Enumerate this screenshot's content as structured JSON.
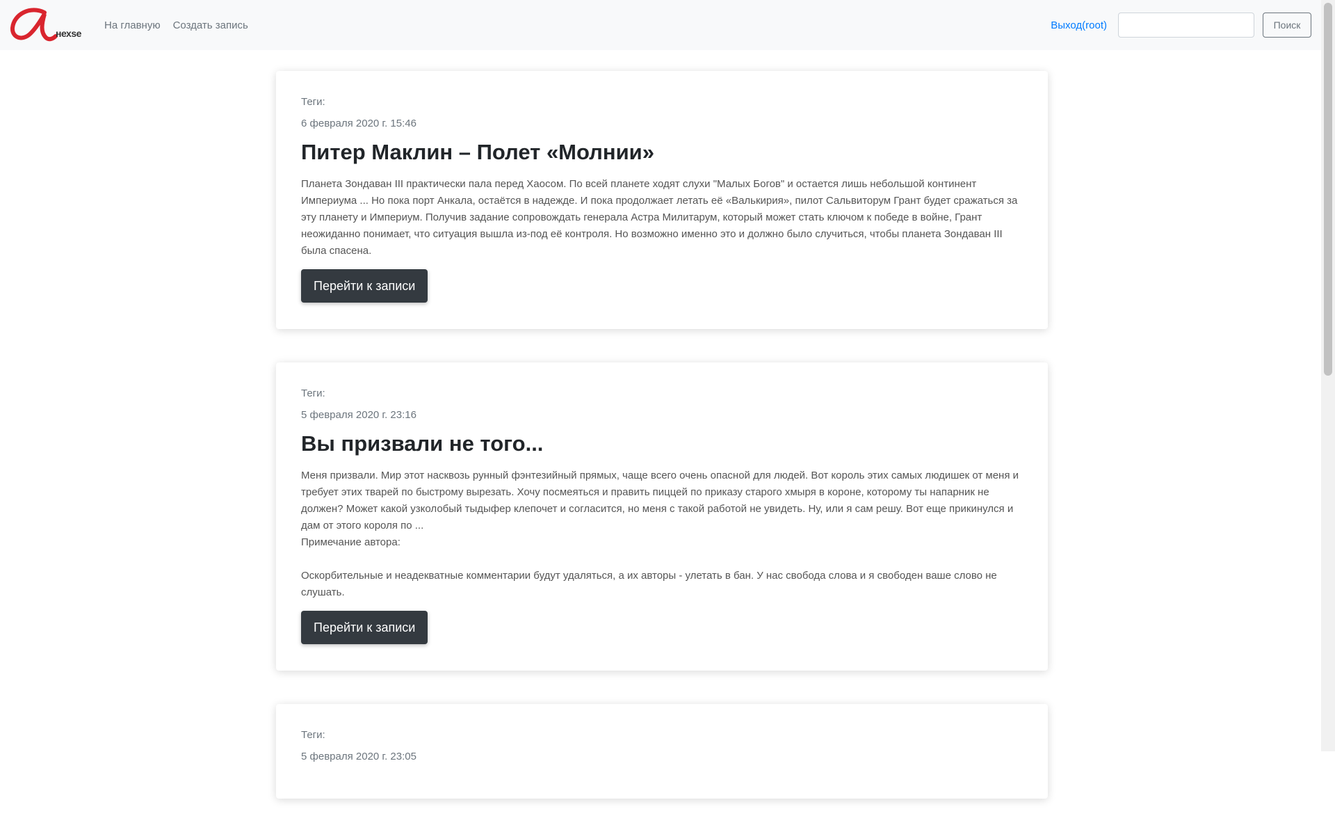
{
  "navbar": {
    "logo_text": "нехse",
    "links": [
      "На главную",
      "Создать запись"
    ],
    "user_link": "Выход(root)",
    "search_placeholder": "",
    "search_button": "Поиск"
  },
  "colors": {
    "brand_red": "#d9252e",
    "link_blue": "#007bff",
    "button_dark": "#343a40"
  },
  "posts": [
    {
      "tags": "Теги:",
      "date": "6 февраля 2020 г. 15:46",
      "title": "Питер Маклин – Полет «Молнии»",
      "body": "Планета Зондаван III практически пала перед Хаосом. По всей планете ходят слухи \"Малых Богов\" и остается лишь небольшой континент Империума ... Но пока порт Анкала, остаётся в надежде. И пока продолжает летать её «Валькирия», пилот Сальвиторум Грант будет сражаться за эту планету и Империум. Получив задание сопровождать генерала Астра Милитарум, который может стать ключом к победе в войне, Грант неожиданно понимает, что ситуация вышла из-под её контроля. Но возможно именно это и должно было случиться, чтобы планета Зондаван III была спасена.",
      "button": "Перейти к записи"
    },
    {
      "tags": "Теги:",
      "date": "5 февраля 2020 г. 23:16",
      "title": "Вы призвали не того...",
      "body": "Меня призвали. Мир этот насквозь рунный фэнтезийный прямых, чаще всего очень опасной для людей. Вот король этих самых людишек от меня и требует этих тварей по быстрому вырезать. Хочу посмеяться и править пиццей по приказу старого хмыря в короне, которому ты напарник не должен? Может какой узколобый тыдыфер клепочет и согласится, но меня с такой работой не увидеть. Ну, или я сам решу. Вот еще прикинулся и дам от этого короля по ...\nПримечание автора:\n\nОскорбительные и неадекватные комментарии будут удаляться, а их авторы - улетать в бан. У нас свобода слова и я свободен ваше слово не слушать.",
      "button": "Перейти к записи"
    },
    {
      "tags": "Теги:",
      "date": "5 февраля 2020 г. 23:05",
      "title": "",
      "body": "",
      "button": ""
    }
  ]
}
